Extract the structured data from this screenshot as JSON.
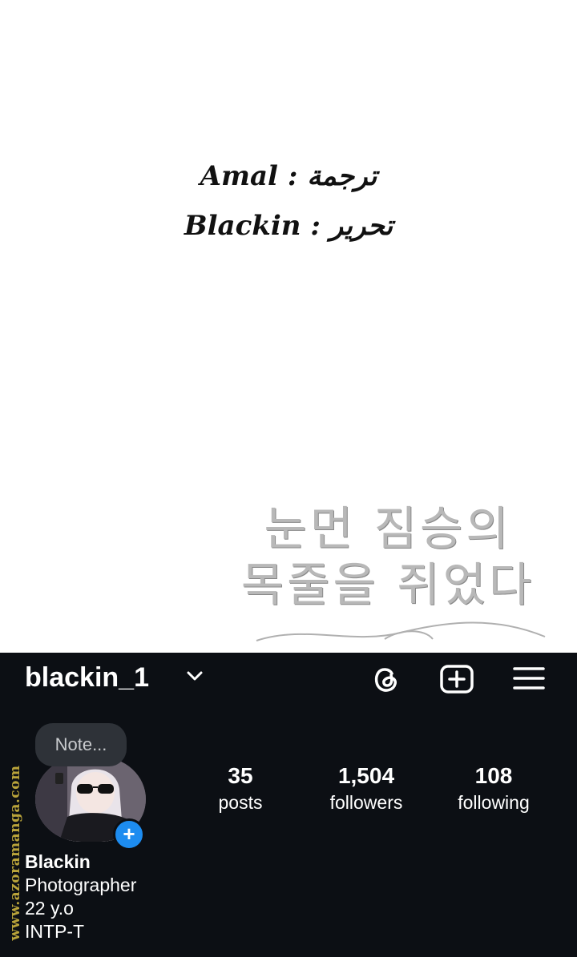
{
  "credits": {
    "line1_role": "ترجمة :",
    "line1_name": "Amal",
    "line2_role": "تحرير :",
    "line2_name": "Blackin"
  },
  "title_korean": {
    "line1": "눈먼 짐승의",
    "line2": "목줄을 쥐었다"
  },
  "profile": {
    "username": "blackin_1",
    "note": "Note...",
    "stats": [
      {
        "num": "35",
        "label": "posts"
      },
      {
        "num": "1,504",
        "label": "followers"
      },
      {
        "num": "108",
        "label": "following"
      }
    ],
    "bio": {
      "name": "Blackin",
      "line1": "Photographer",
      "line2": "22 y.o",
      "line3": "INTP-T"
    },
    "add_badge": "+",
    "accent_color": "#1d8cf0"
  },
  "watermark": "www.azoramanga.com",
  "icons": [
    "chevron-down-icon",
    "threads-icon",
    "new-post-icon",
    "menu-icon"
  ]
}
